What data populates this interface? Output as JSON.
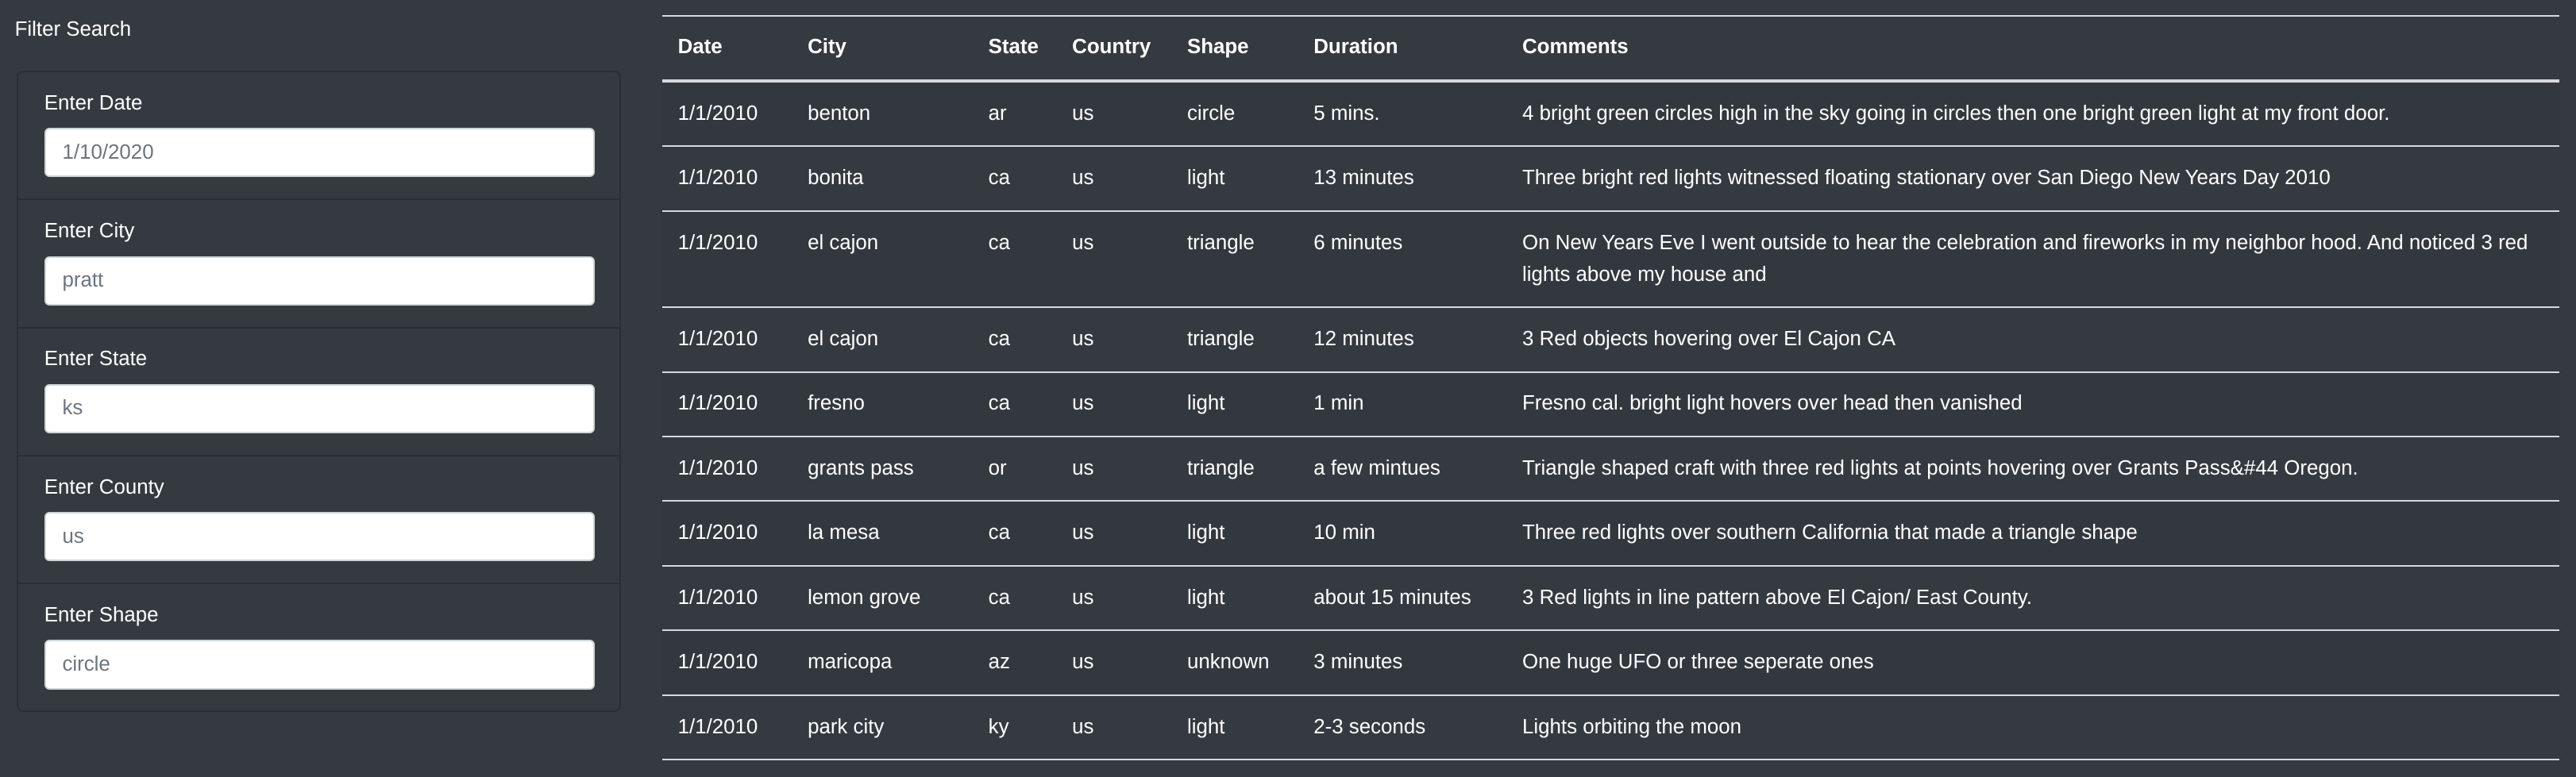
{
  "sidebar": {
    "title": "Filter Search",
    "filters": [
      {
        "label": "Enter Date",
        "placeholder": "1/10/2020"
      },
      {
        "label": "Enter City",
        "placeholder": "pratt"
      },
      {
        "label": "Enter State",
        "placeholder": "ks"
      },
      {
        "label": "Enter County",
        "placeholder": "us"
      },
      {
        "label": "Enter Shape",
        "placeholder": "circle"
      }
    ]
  },
  "table": {
    "headers": [
      "Date",
      "City",
      "State",
      "Country",
      "Shape",
      "Duration",
      "Comments"
    ],
    "rows": [
      [
        "1/1/2010",
        "benton",
        "ar",
        "us",
        "circle",
        "5 mins.",
        "4 bright green circles high in the sky going in circles then one bright green light at my front door."
      ],
      [
        "1/1/2010",
        "bonita",
        "ca",
        "us",
        "light",
        "13 minutes",
        "Three bright red lights witnessed floating stationary over San Diego New Years Day 2010"
      ],
      [
        "1/1/2010",
        "el cajon",
        "ca",
        "us",
        "triangle",
        "6 minutes",
        "On New Years Eve I went outside to hear the celebration and fireworks in my neighbor hood. And noticed 3 red lights above my house and"
      ],
      [
        "1/1/2010",
        "el cajon",
        "ca",
        "us",
        "triangle",
        "12 minutes",
        "3 Red objects hovering over El Cajon CA"
      ],
      [
        "1/1/2010",
        "fresno",
        "ca",
        "us",
        "light",
        "1 min",
        "Fresno cal. bright light hovers over head then vanished"
      ],
      [
        "1/1/2010",
        "grants pass",
        "or",
        "us",
        "triangle",
        "a few mintues",
        "Triangle shaped craft with three red lights at points hovering over Grants Pass&#44 Oregon."
      ],
      [
        "1/1/2010",
        "la mesa",
        "ca",
        "us",
        "light",
        "10 min",
        "Three red lights over southern California that made a triangle shape"
      ],
      [
        "1/1/2010",
        "lemon grove",
        "ca",
        "us",
        "light",
        "about 15 minutes",
        "3 Red lights in line pattern above El Cajon/ East County."
      ],
      [
        "1/1/2010",
        "maricopa",
        "az",
        "us",
        "unknown",
        "3 minutes",
        "One huge UFO or three seperate ones"
      ],
      [
        "1/1/2010",
        "park city",
        "ky",
        "us",
        "light",
        "2-3 seconds",
        "Lights orbiting the moon"
      ]
    ]
  },
  "colors": {
    "background": "#343a40",
    "border": "#d6d8db",
    "input_bg": "#ffffff"
  }
}
